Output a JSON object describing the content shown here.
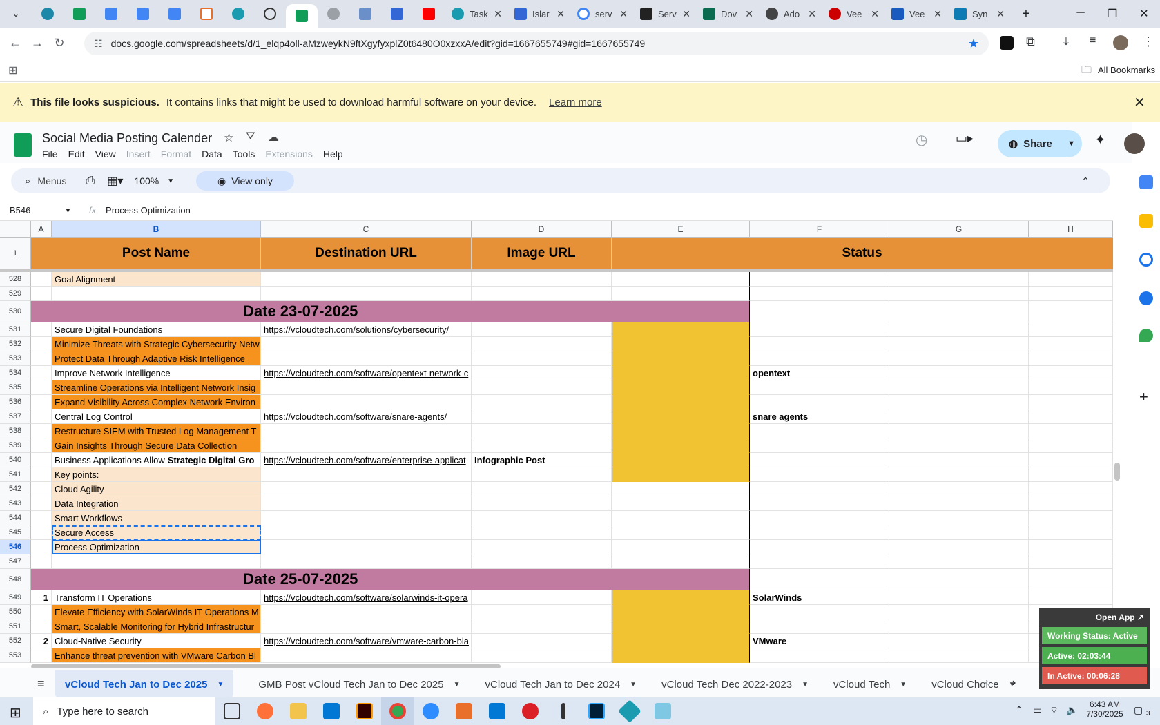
{
  "browser": {
    "tabs": [
      "",
      "",
      "",
      "",
      "",
      "",
      "",
      "",
      "",
      "",
      "",
      "",
      "Task",
      "Islar",
      "serv",
      "Serv",
      "Dov",
      "Ado",
      "Vee",
      "Vee",
      "Syn"
    ],
    "url": "docs.google.com/spreadsheets/d/1_elqp4oll-aMzweykN9ftXgyfyxplZ0t6480O0xzxxA/edit?gid=1667655749#gid=1667655749",
    "bookmarks_label": "All Bookmarks"
  },
  "warning": {
    "title": "This file looks suspicious.",
    "message": "It contains links that might be used to download harmful software on your device.",
    "link": "Learn more"
  },
  "doc": {
    "title": "Social Media Posting Calender",
    "menus": [
      "File",
      "Edit",
      "View",
      "Insert",
      "Format",
      "Data",
      "Tools",
      "Extensions",
      "Help"
    ],
    "share_label": "Share"
  },
  "toolbar": {
    "search_label": "Menus",
    "zoom": "100%",
    "view_only": "View only"
  },
  "formula_bar": {
    "cell_ref": "B546",
    "fx": "fx",
    "value": "Process Optimization"
  },
  "columns": [
    "A",
    "B",
    "C",
    "D",
    "E",
    "F",
    "G",
    "H"
  ],
  "header_row": {
    "row": "1",
    "post_name": "Post Name",
    "destination_url": "Destination URL",
    "image_url": "Image URL",
    "status": "Status"
  },
  "rows": [
    {
      "n": "528",
      "a": "",
      "b": "Goal Alignment",
      "c": "",
      "d": "",
      "f": "",
      "style": "pe"
    },
    {
      "n": "529",
      "a": "",
      "b": "",
      "c": "",
      "d": "",
      "f": "",
      "style": ""
    },
    {
      "n": "530",
      "date": "Date 23-07-2025"
    },
    {
      "n": "531",
      "a": "",
      "b": "Secure Digital Foundations",
      "c": "https://vcloudtech.com/solutions/cybersecurity/",
      "d": "",
      "f": "",
      "style": "",
      "e": "yl"
    },
    {
      "n": "532",
      "a": "",
      "b": "Minimize Threats with Strategic Cybersecurity Netw",
      "c": "",
      "d": "",
      "f": "",
      "style": "or",
      "e": "yl"
    },
    {
      "n": "533",
      "a": "",
      "b": "Protect Data Through Adaptive Risk Intelligence",
      "c": "",
      "d": "",
      "f": "",
      "style": "or",
      "e": "yl"
    },
    {
      "n": "534",
      "a": "",
      "b": "Improve Network Intelligence",
      "c": "https://vcloudtech.com/software/opentext-network-c",
      "d": "",
      "f": "opentext",
      "style": "",
      "e": "yl"
    },
    {
      "n": "535",
      "a": "",
      "b": "Streamline Operations via Intelligent Network Insig",
      "c": "",
      "d": "",
      "f": "",
      "style": "or",
      "e": "yl"
    },
    {
      "n": "536",
      "a": "",
      "b": "Expand Visibility Across Complex Network Environ",
      "c": "",
      "d": "",
      "f": "",
      "style": "or",
      "e": "yl"
    },
    {
      "n": "537",
      "a": "",
      "b": "Central Log Control",
      "c": "https://vcloudtech.com/software/snare-agents/",
      "d": "",
      "f": "snare agents",
      "style": "",
      "e": "yl"
    },
    {
      "n": "538",
      "a": "",
      "b": "Restructure SIEM with Trusted Log Management T",
      "c": "",
      "d": "",
      "f": "",
      "style": "or",
      "e": "yl"
    },
    {
      "n": "539",
      "a": "",
      "b": "Gain Insights Through Secure Data Collection",
      "c": "",
      "d": "",
      "f": "",
      "style": "or",
      "e": "yl"
    },
    {
      "n": "540",
      "a": "",
      "b": "Business Applications Allow ",
      "b_bold": "Strategic Digital Gro",
      "c": "https://vcloudtech.com/software/enterprise-applicat",
      "d": "Infographic Post",
      "f": "",
      "style": "",
      "e": "yl"
    },
    {
      "n": "541",
      "a": "",
      "b": "Key points:",
      "c": "",
      "d": "",
      "f": "",
      "style": "pe",
      "e": "yl"
    },
    {
      "n": "542",
      "a": "",
      "b": "Cloud Agility",
      "c": "",
      "d": "",
      "f": "",
      "style": "pe"
    },
    {
      "n": "543",
      "a": "",
      "b": "Data Integration",
      "c": "",
      "d": "",
      "f": "",
      "style": "pe"
    },
    {
      "n": "544",
      "a": "",
      "b": "Smart Workflows",
      "c": "",
      "d": "",
      "f": "",
      "style": "pe"
    },
    {
      "n": "545",
      "a": "",
      "b": "Secure Access",
      "c": "",
      "d": "",
      "f": "",
      "style": "pe",
      "dashed": true
    },
    {
      "n": "546",
      "a": "",
      "b": "Process Optimization",
      "c": "",
      "d": "",
      "f": "",
      "style": "pe",
      "selected": true
    },
    {
      "n": "547",
      "a": "",
      "b": "",
      "c": "",
      "d": "",
      "f": "",
      "style": ""
    },
    {
      "n": "548",
      "date": "Date 25-07-2025"
    },
    {
      "n": "549",
      "a": "1",
      "b": "Transform IT Operations",
      "c": "https://vcloudtech.com/software/solarwinds-it-opera",
      "d": "",
      "f": "SolarWinds",
      "style": "",
      "e": "yl"
    },
    {
      "n": "550",
      "a": "",
      "b": "Elevate Efficiency with SolarWinds IT Operations M",
      "c": "",
      "d": "",
      "f": "",
      "style": "or",
      "e": "yl"
    },
    {
      "n": "551",
      "a": "",
      "b": "Smart, Scalable Monitoring for Hybrid Infrastructur",
      "c": "",
      "d": "",
      "f": "",
      "style": "or",
      "e": "yl"
    },
    {
      "n": "552",
      "a": "2",
      "b": "Cloud-Native Security",
      "c": "https://vcloudtech.com/software/vmware-carbon-bla",
      "d": "",
      "f": "VMware",
      "style": "",
      "e": "yl"
    },
    {
      "n": "553",
      "a": "",
      "b": "Enhance threat prevention with VMware Carbon Bl",
      "c": "",
      "d": "",
      "f": "",
      "style": "or",
      "e": "yl"
    }
  ],
  "sheet_tabs": [
    "vCloud Tech Jan to Dec 2025",
    "GMB Post vCloud Tech Jan to Dec 2025",
    "vCloud Tech Jan to Dec 2024",
    "vCloud Tech Dec 2022-2023",
    "vCloud Tech",
    "vCloud Choice"
  ],
  "widget": {
    "open_app": "Open App ↗",
    "working_status": "Working Status: Active",
    "active": "Active: 02:03:44",
    "inactive": "In Active: 00:06:28",
    "colors": {
      "working": "#4caf50",
      "active": "#4caf50",
      "inactive": "#e57373"
    }
  },
  "taskbar": {
    "search_placeholder": "Type here to search",
    "time": "6:43 AM",
    "date": "7/30/2025",
    "notifications": "3"
  }
}
